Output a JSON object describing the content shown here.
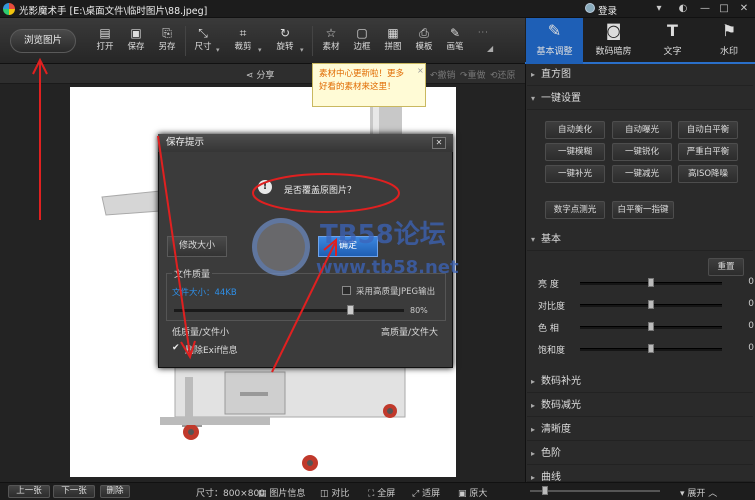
{
  "titlebar": {
    "title": "光影魔术手 [E:\\桌面文件\\临时图片\\88.jpeg]",
    "login": "登录"
  },
  "toolbar": {
    "browse": "浏览图片",
    "tools": [
      "打开",
      "保存",
      "另存",
      "尺寸",
      "裁剪",
      "旋转",
      "素材",
      "边框",
      "拼图",
      "模板",
      "画笔"
    ]
  },
  "right_tabs": [
    "基本调整",
    "数码暗房",
    "文字",
    "水印"
  ],
  "subbar": {
    "share": "分享",
    "undo": "撤销",
    "redo": "重做",
    "restore": "还原"
  },
  "tooltip": {
    "line1": "素材中心更新啦！更多",
    "line2": "好看的素材来这里！"
  },
  "panel": {
    "histogram": "直方图",
    "one_click": "一键设置",
    "one_click_buttons": [
      "自动美化",
      "自动曝光",
      "自动白平衡",
      "一键模糊",
      "一键锐化",
      "严重白平衡",
      "一键补光",
      "一键减光",
      "高ISO降噪"
    ],
    "wide_buttons": [
      "数字点测光",
      "白平衡一指键"
    ],
    "basic": "基本",
    "reset": "重置",
    "sliders": [
      {
        "label": "亮 度",
        "value": "0",
        "level": 0.5
      },
      {
        "label": "对比度",
        "value": "0",
        "level": 0.5
      },
      {
        "label": "色 相",
        "value": "0",
        "level": 0.5
      },
      {
        "label": "饱和度",
        "value": "0",
        "level": 0.5
      }
    ],
    "sections": [
      "数码补光",
      "数码减光",
      "清晰度",
      "色阶",
      "曲线"
    ]
  },
  "dialog": {
    "title": "保存提示",
    "message": "是否覆盖原图片？",
    "resize": "修改大小",
    "ok": "确定",
    "quality_title": "文件质量",
    "filesize": "文件大小：44KB",
    "hq_label": "采用高质量JPEG输出",
    "quality_value": "80%",
    "quality_level": 0.8,
    "low": "低质量/文件小",
    "high": "高质量/文件大",
    "exif": "删除Exif信息"
  },
  "watermark": {
    "line1": "TB58论坛",
    "line2": "www.tb58.net"
  },
  "statusbar": {
    "prev": "上一张",
    "next": "下一张",
    "delete": "删除",
    "size": "尺寸：800×800",
    "info": "图片信息",
    "compare": "对比",
    "fullscreen": "全屏",
    "fit": "适屏",
    "original": "原大",
    "expand": "展开"
  },
  "colors": {
    "accent": "#1e5fb6",
    "annotation": "#e02020"
  }
}
